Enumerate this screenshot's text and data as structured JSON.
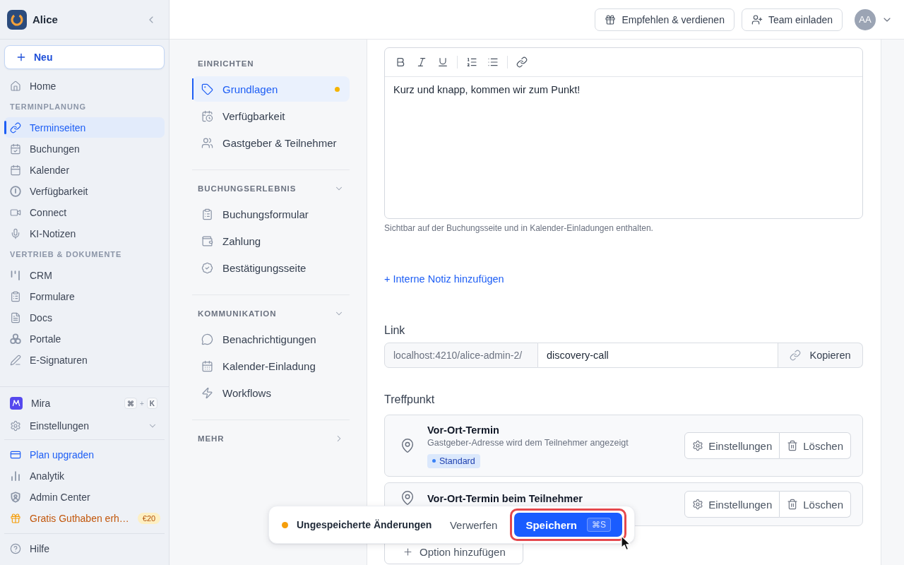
{
  "sidebar": {
    "workspace": "Alice",
    "new_button": "Neu",
    "nav_groups": [
      {
        "items": [
          {
            "label": "Home",
            "selected": false
          }
        ]
      },
      {
        "heading": "TERMINPLANUNG",
        "items": [
          {
            "label": "Terminseiten",
            "selected": true
          },
          {
            "label": "Buchungen",
            "selected": false
          },
          {
            "label": "Kalender",
            "selected": false
          },
          {
            "label": "Verfügbarkeit",
            "selected": false
          },
          {
            "label": "Connect",
            "selected": false
          },
          {
            "label": "KI-Notizen",
            "selected": false
          }
        ]
      },
      {
        "heading": "VERTRIEB & DOKUMENTE",
        "items": [
          {
            "label": "CRM",
            "selected": false
          },
          {
            "label": "Formulare",
            "selected": false
          },
          {
            "label": "Docs",
            "selected": false
          },
          {
            "label": "Portale",
            "selected": false
          },
          {
            "label": "E-Signaturen",
            "selected": false
          }
        ]
      }
    ],
    "footer_groups": [
      {
        "items": [
          {
            "kind": "assistant",
            "label": "Mira",
            "selected": false,
            "shortcut": {
              "keys": [
                "⌘",
                "K"
              ],
              "joiner": "+"
            }
          },
          {
            "kind": "menu",
            "label": "Einstellungen",
            "selected": false,
            "expanded": false
          }
        ]
      },
      {
        "items": [
          {
            "kind": "upgrade",
            "label": "Plan upgraden",
            "selected": false
          },
          {
            "kind": "link",
            "label": "Analytik",
            "selected": false
          },
          {
            "kind": "link",
            "label": "Admin Center",
            "selected": false
          },
          {
            "kind": "promo",
            "label": "Gratis Guthaben erh…",
            "badge": "€20",
            "selected": false
          }
        ]
      },
      {
        "items": [
          {
            "kind": "link",
            "label": "Hilfe",
            "selected": false
          }
        ]
      }
    ]
  },
  "header": {
    "buttons": [
      "Empfehlen & verdienen",
      "Team einladen"
    ],
    "avatar": "AA"
  },
  "setup_nav": {
    "groups": [
      {
        "heading": "EINRICHTEN",
        "items": [
          {
            "label": "Grundlagen",
            "selected": true,
            "unsaved": true
          },
          {
            "label": "Verfügbarkeit",
            "selected": false,
            "unsaved": false
          },
          {
            "label": "Gastgeber & Teilnehmer",
            "selected": false,
            "unsaved": false
          }
        ]
      },
      {
        "heading": "BUCHUNGSERLEBNIS",
        "expanded": true,
        "items": [
          {
            "label": "Buchungsformular",
            "selected": false,
            "unsaved": false
          },
          {
            "label": "Zahlung",
            "selected": false,
            "unsaved": false
          },
          {
            "label": "Bestätigungsseite",
            "selected": false,
            "unsaved": false
          }
        ]
      },
      {
        "heading": "KOMMUNIKATION",
        "expanded": true,
        "items": [
          {
            "label": "Benachrichtigungen",
            "selected": false,
            "unsaved": false
          },
          {
            "label": "Kalender-Einladung",
            "selected": false,
            "unsaved": false
          },
          {
            "label": "Workflows",
            "selected": false,
            "unsaved": false
          }
        ]
      },
      {
        "heading": "MEHR",
        "expanded": false
      }
    ]
  },
  "form": {
    "description": {
      "value": "Kurz und knapp, kommen wir zum Punkt!",
      "hint": "Sichtbar auf der Buchungsseite und in Kalender-Einladungen enthalten."
    },
    "internal_note_link": "+ Interne Notiz hinzufügen",
    "link": {
      "label": "Link",
      "prefix": "localhost:4210/alice-admin-2/",
      "value": "discovery-call",
      "copy_button": "Kopieren"
    },
    "meeting_point": {
      "label": "Treffpunkt",
      "options": [
        {
          "title": "Vor-Ort-Termin",
          "description": "Gastgeber-Adresse wird dem Teilnehmer angezeigt",
          "badge": "Standard",
          "actions": [
            "Einstellungen",
            "Löschen"
          ]
        },
        {
          "title": "Vor-Ort-Termin beim Teilnehmer",
          "actions": [
            "Einstellungen",
            "Löschen"
          ]
        }
      ],
      "add_button": "Option hinzufügen"
    }
  },
  "toast": {
    "message": "Ungespeicherte Änderungen",
    "discard": "Verwerfen",
    "save": "Speichern",
    "shortcut": "⌘S",
    "highlighted": true
  }
}
